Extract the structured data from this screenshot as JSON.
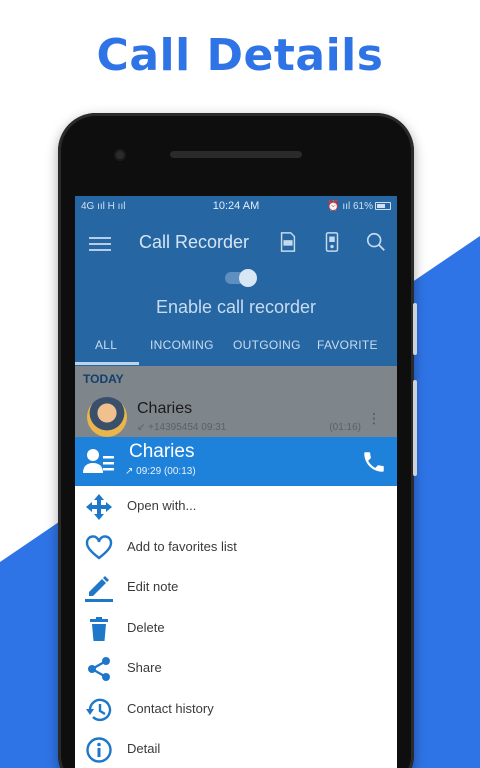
{
  "headline": "Call Details",
  "status_bar": {
    "left": "4G ııl  H ııl",
    "time": "10:24 AM",
    "right": "⏰ ııl 61%"
  },
  "app": {
    "title": "Call Recorder",
    "enable_label": "Enable call recorder",
    "tabs": [
      "ALL",
      "INCOMING",
      "OUTGOING",
      "FAVORITE"
    ]
  },
  "list": {
    "section": "TODAY",
    "item": {
      "name": "Charies",
      "meta": "↙ +14395454  09:31",
      "duration": "(01:16)",
      "more": "⋮"
    }
  },
  "detail": {
    "name": "Charies",
    "meta": "↗ 09:29  (00:13)"
  },
  "menu": [
    {
      "label": "Open with...",
      "icon": "move-arrows-icon"
    },
    {
      "label": "Add to favorites list",
      "icon": "heart-icon"
    },
    {
      "label": "Edit note",
      "icon": "pencil-icon"
    },
    {
      "label": "Delete",
      "icon": "trash-icon"
    },
    {
      "label": "Share",
      "icon": "share-icon"
    },
    {
      "label": "Contact history",
      "icon": "history-icon"
    },
    {
      "label": "Detail",
      "icon": "info-icon"
    }
  ],
  "colors": {
    "accent": "#2f74e6",
    "header_blue": "#1e82db",
    "icon_blue": "#1e77c8"
  }
}
